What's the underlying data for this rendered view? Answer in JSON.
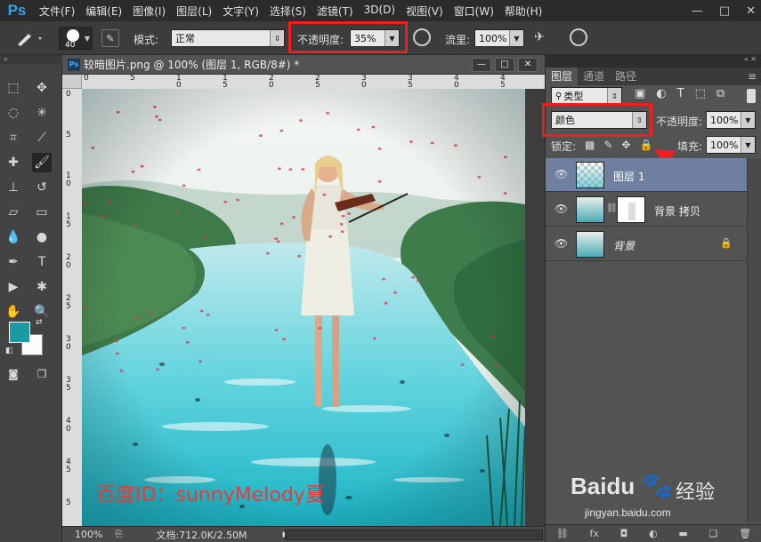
{
  "app": {
    "logo": "Ps"
  },
  "menu": [
    "文件(F)",
    "编辑(E)",
    "图像(I)",
    "图层(L)",
    "文字(Y)",
    "选择(S)",
    "滤镜(T)",
    "3D(D)",
    "视图(V)",
    "窗口(W)",
    "帮助(H)"
  ],
  "window_controls": {
    "minimize": "—",
    "maximize": "□",
    "close": "✕"
  },
  "options": {
    "brush_size": "40",
    "mode_label": "模式:",
    "mode_value": "正常",
    "opacity_label": "不透明度:",
    "opacity_value": "35%",
    "flow_label": "流里:",
    "flow_value": "100%"
  },
  "document": {
    "tab_title": "较暗图片.png @ 100% (图层 1, RGB/8#) *",
    "ruler_top": [
      "0",
      "5",
      "1\n0",
      "1\n5",
      "2\n0",
      "2\n5",
      "3\n0",
      "3\n5",
      "4\n0",
      "4\n5"
    ],
    "ruler_left": [
      "0",
      "5",
      "1\n0",
      "1\n5",
      "2\n0",
      "2\n5",
      "3\n0",
      "3\n5",
      "4\n0",
      "4\n5",
      "5"
    ],
    "watermark": "百度ID：sunnyMelody夏",
    "status_zoom": "100%",
    "status_doc": "文档:712.0K/2.50M"
  },
  "panel": {
    "tabs": [
      "图层",
      "通道",
      "路径"
    ],
    "filter_label": "类型",
    "blend_mode": "颜色",
    "opacity_label": "不透明度:",
    "opacity_value": "100%",
    "lock_label": "锁定:",
    "fill_label": "填充:",
    "fill_value": "100%",
    "layers": [
      {
        "name": "图层 1"
      },
      {
        "name": "背景 拷贝"
      },
      {
        "name": "背景"
      }
    ]
  },
  "baidu": {
    "brand": "Baidu",
    "brand2": "经验",
    "url": "jingyan.baidu.com"
  },
  "colors": {
    "foreground": "#1a9aa2",
    "background": "#ffffff",
    "highlight": "#f01e1e",
    "selected_layer": "#6e7fa0"
  }
}
